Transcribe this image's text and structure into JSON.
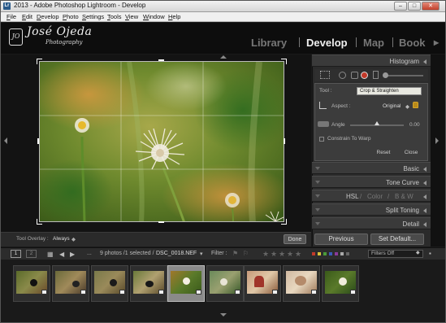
{
  "window": {
    "title": "2013 - Adobe Photoshop Lightroom - Develop"
  },
  "menu": [
    "File",
    "Edit",
    "Develop",
    "Photo",
    "Settings",
    "Tools",
    "View",
    "Window",
    "Help"
  ],
  "brand": {
    "badge": "JO",
    "name": "José Ojeda",
    "sub": "Photography"
  },
  "modules": {
    "library": "Library",
    "develop": "Develop",
    "map": "Map",
    "book": "Book"
  },
  "panels": {
    "histogram": "Histogram",
    "basic": "Basic",
    "tone_curve": "Tone Curve",
    "hsl": "HSL",
    "color": "Color",
    "bw": "B & W",
    "split_toning": "Split Toning",
    "detail": "Detail"
  },
  "crop": {
    "tool_label": "Tool :",
    "tooltip": "Crop & Straighten",
    "aspect_label": "Aspect :",
    "aspect_value": "Original",
    "angle_label": "Angle",
    "angle_value": "0.00",
    "constrain_label": "Constrain To Warp",
    "reset": "Reset",
    "close": "Close"
  },
  "toolbar": {
    "overlay_label": "Tool Overlay :",
    "overlay_value": "Always",
    "done": "Done"
  },
  "buttons": {
    "previous": "Previous",
    "set_default": "Set Default..."
  },
  "filmstrip": {
    "page1": "1",
    "page2": "2",
    "dots": "...",
    "status": "9 photos /1 selected /",
    "filename": "DSC_0018.NEF",
    "filter_label": "Filter :",
    "filters_value": "Filters Off"
  },
  "colors": {
    "accent": "#c23a2a",
    "bg": "#1a1a1a",
    "panel": "#2b2b2b"
  }
}
